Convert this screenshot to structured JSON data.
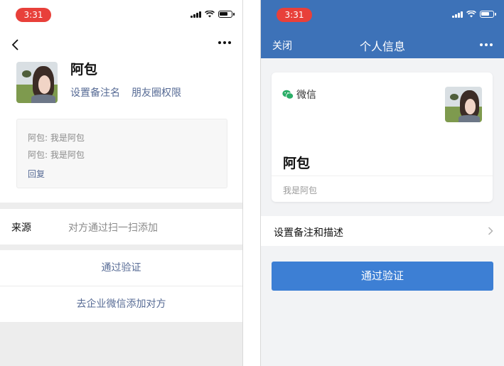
{
  "left_screen": {
    "status_time": "3:31",
    "contact_name": "阿包",
    "links": [
      "设置备注名",
      "朋友圈权限"
    ],
    "messages": [
      "阿包: 我是阿包",
      "阿包: 我是阿包"
    ],
    "reply_label": "回复",
    "source_label": "来源",
    "source_value": "对方通过扫一扫添加",
    "actions": [
      "通过验证",
      "去企业微信添加对方"
    ]
  },
  "right_screen": {
    "status_time": "3:31",
    "close_label": "关闭",
    "title": "个人信息",
    "wechat_label": "微信",
    "contact_name": "阿包",
    "greeting": "我是阿包",
    "settings_row_label": "设置备注和描述",
    "verify_button_label": "通过验证"
  },
  "icons": [
    "back-icon",
    "more-icon",
    "signal-icon",
    "wifi-icon",
    "battery-icon",
    "wechat-icon",
    "chevron-right-icon"
  ],
  "colors": {
    "link_blue": "#576b95",
    "header_blue": "#3d72b8",
    "button_blue": "#3d7fd4",
    "time_pill_red": "#e8403a"
  }
}
